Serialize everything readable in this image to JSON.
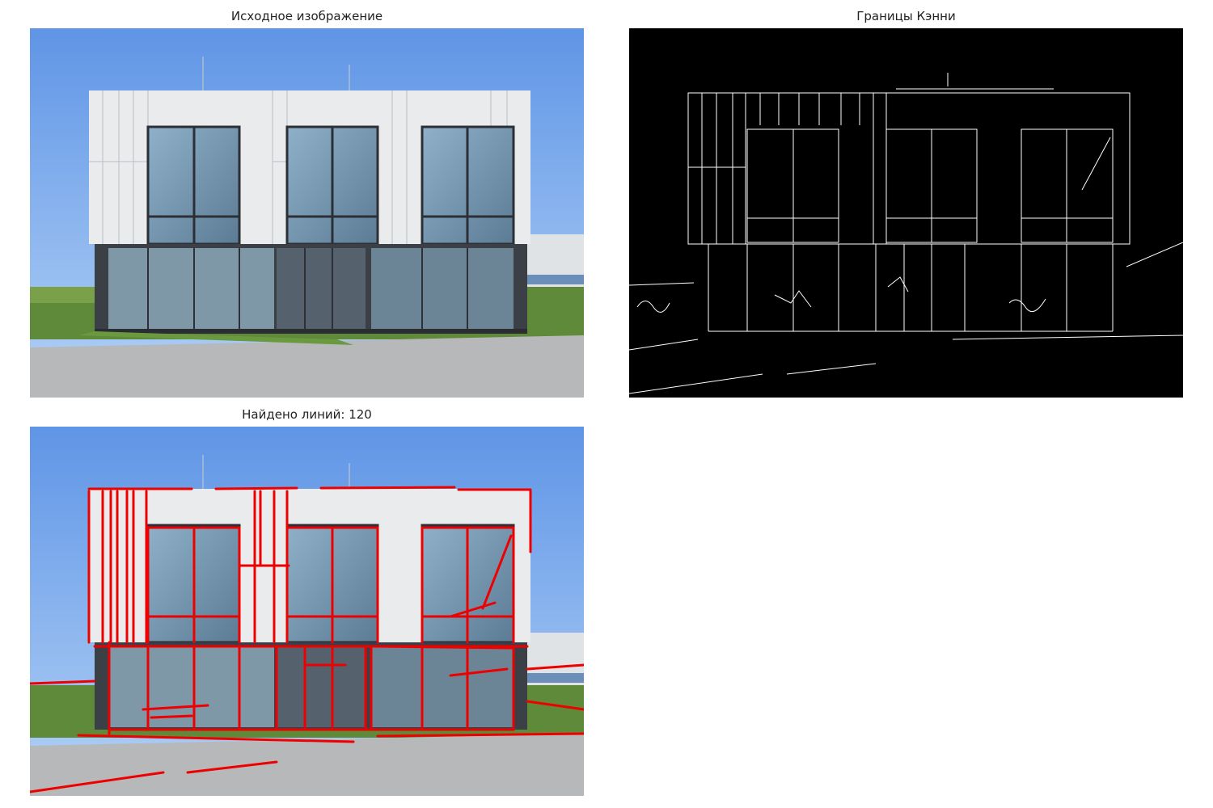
{
  "panels": {
    "original": {
      "title": "Исходное изображение"
    },
    "edges": {
      "title": "Границы Кэнни"
    },
    "lines": {
      "title": "Найдено линий: 120"
    }
  },
  "colors": {
    "sky_top": "#5f95e6",
    "sky_bottom": "#a9ccf6",
    "panel_white": "#e9ebec",
    "panel_line": "#b9bec4",
    "window_glass": "#6e8ea8",
    "window_frame": "#2c3036",
    "dark_base": "#3b4047",
    "grass": "#5f8a3a",
    "pavement": "#b6b8ba",
    "detected_line": "#ee0000",
    "edge_bg": "#000000",
    "edge_stroke": "#ffffff"
  }
}
